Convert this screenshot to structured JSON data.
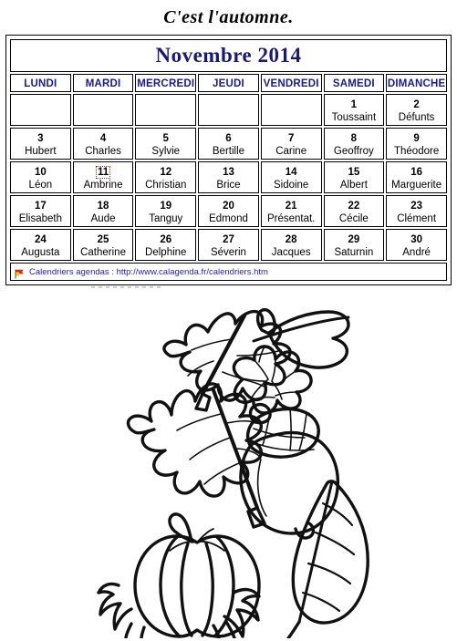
{
  "page": {
    "title": "C'est l'automne."
  },
  "calendar": {
    "month_title": "Novembre 2014",
    "weekdays": [
      "LUNDI",
      "MARDI",
      "MERCREDI",
      "JEUDI",
      "VENDREDI",
      "SAMEDI",
      "DIMANCHE"
    ],
    "highlight_day": "11",
    "colors": {
      "month_title": "#1a1a6e",
      "weekday": "#1a1a8c",
      "link": "#2222aa",
      "highlight_border": "#993333",
      "grid": "#000000"
    },
    "weeks": [
      [
        {
          "num": "",
          "name": "",
          "empty": true
        },
        {
          "num": "",
          "name": "",
          "empty": true
        },
        {
          "num": "",
          "name": "",
          "empty": true
        },
        {
          "num": "",
          "name": "",
          "empty": true
        },
        {
          "num": "",
          "name": "",
          "empty": true
        },
        {
          "num": "1",
          "name": "Toussaint",
          "empty": false
        },
        {
          "num": "2",
          "name": "Défunts",
          "empty": false
        }
      ],
      [
        {
          "num": "3",
          "name": "Hubert",
          "empty": false
        },
        {
          "num": "4",
          "name": "Charles",
          "empty": false
        },
        {
          "num": "5",
          "name": "Sylvie",
          "empty": false
        },
        {
          "num": "6",
          "name": "Bertille",
          "empty": false
        },
        {
          "num": "7",
          "name": "Carine",
          "empty": false
        },
        {
          "num": "8",
          "name": "Geoffroy",
          "empty": false
        },
        {
          "num": "9",
          "name": "Théodore",
          "empty": false
        }
      ],
      [
        {
          "num": "10",
          "name": "Léon",
          "empty": false
        },
        {
          "num": "11",
          "name": "Ambrine",
          "empty": false,
          "highlighted": true
        },
        {
          "num": "12",
          "name": "Christian",
          "empty": false
        },
        {
          "num": "13",
          "name": "Brice",
          "empty": false
        },
        {
          "num": "14",
          "name": "Sidoine",
          "empty": false
        },
        {
          "num": "15",
          "name": "Albert",
          "empty": false
        },
        {
          "num": "16",
          "name": "Marguerite",
          "empty": false
        }
      ],
      [
        {
          "num": "17",
          "name": "Elisabeth",
          "empty": false
        },
        {
          "num": "18",
          "name": "Aude",
          "empty": false
        },
        {
          "num": "19",
          "name": "Tanguy",
          "empty": false
        },
        {
          "num": "20",
          "name": "Edmond",
          "empty": false
        },
        {
          "num": "21",
          "name": "Présentat.",
          "empty": false
        },
        {
          "num": "22",
          "name": "Cécile",
          "empty": false
        },
        {
          "num": "23",
          "name": "Clément",
          "empty": false
        }
      ],
      [
        {
          "num": "24",
          "name": "Augusta",
          "empty": false
        },
        {
          "num": "25",
          "name": "Catherine",
          "empty": false
        },
        {
          "num": "26",
          "name": "Delphine",
          "empty": false
        },
        {
          "num": "27",
          "name": "Séverin",
          "empty": false
        },
        {
          "num": "28",
          "name": "Jacques",
          "empty": false
        },
        {
          "num": "29",
          "name": "Saturnin",
          "empty": false
        },
        {
          "num": "30",
          "name": "André",
          "empty": false
        }
      ]
    ],
    "footer": {
      "icon": "flag-icon",
      "text": "Calendriers agendas : http://www.calagenda.fr/calendriers.htm"
    }
  },
  "illustration": {
    "description": "Autumn coloring-book line drawings",
    "items": [
      "maple-leaf",
      "pine-cone",
      "oak-leaf",
      "acorn",
      "pumpkin",
      "simple-leaf"
    ]
  }
}
